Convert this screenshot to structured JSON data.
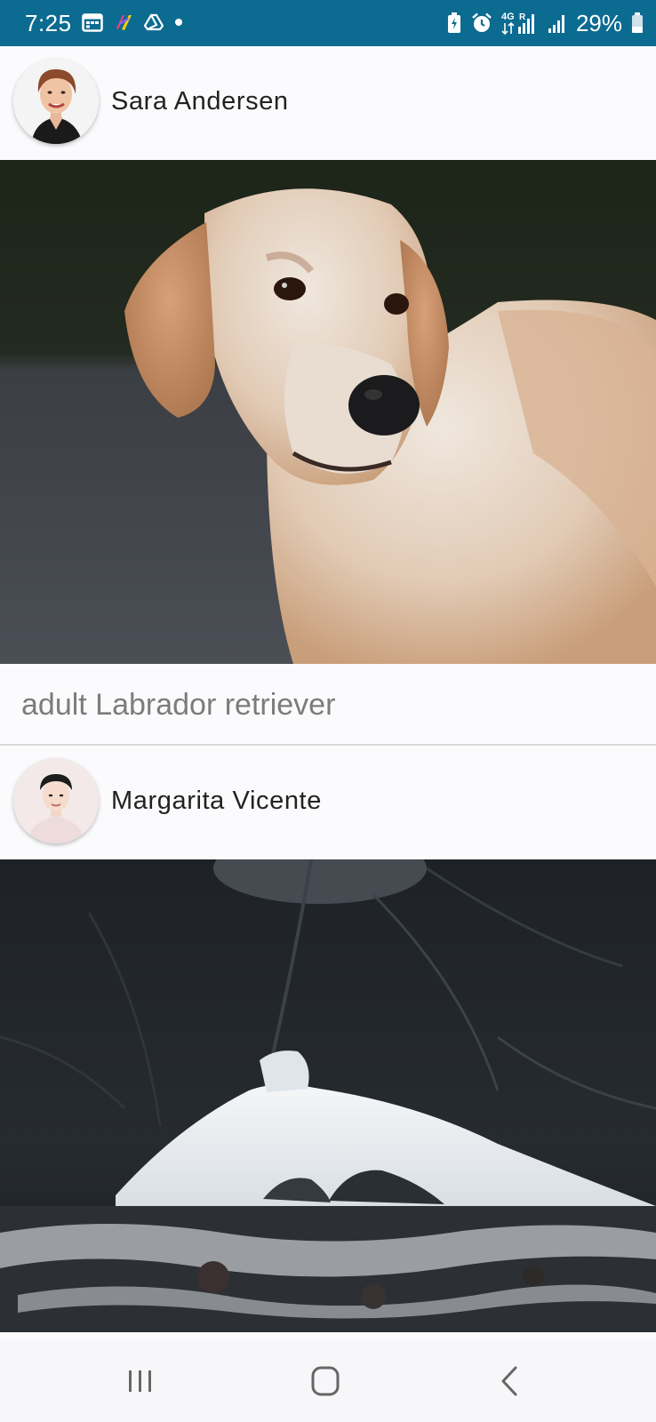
{
  "status_bar": {
    "time": "7:25",
    "network": "4G",
    "battery_text": "29%",
    "background_color": "#0c6b91",
    "left_icons": [
      "calendar-icon",
      "app-logo-icon",
      "drive-icon",
      "notification-dot-icon"
    ],
    "right_icons": [
      "battery-saver-icon",
      "alarm-icon",
      "signal-4g-icon",
      "signal-icon",
      "battery-icon"
    ]
  },
  "feed": {
    "posts": [
      {
        "author": "Sara Andersen",
        "image_subject": "dog",
        "caption": "adult Labrador retriever"
      },
      {
        "author": "Margarita Vicente",
        "image_subject": "ice cave landscape"
      }
    ]
  },
  "nav_bar": {
    "buttons": [
      "recent-apps-icon",
      "home-icon",
      "back-icon"
    ]
  }
}
